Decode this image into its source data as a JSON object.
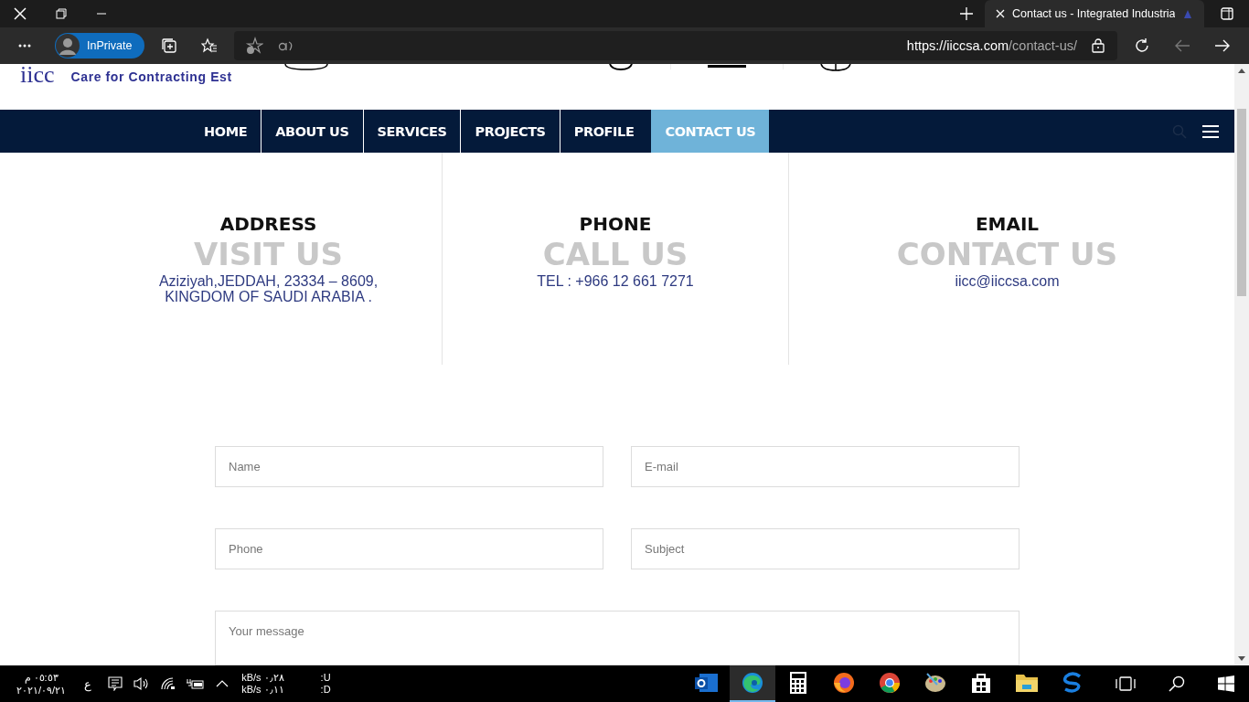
{
  "browser": {
    "tab_title": "Contact us - Integrated Industria",
    "profile": "InPrivate",
    "url_host": "https://iiccsa.com",
    "url_path": "/contact-us/"
  },
  "site": {
    "logo": "iicc",
    "tagline": "Care for Contracting Est"
  },
  "nav": [
    {
      "label": "HOME",
      "selected": false
    },
    {
      "label": "ABOUT US",
      "selected": false
    },
    {
      "label": "SERVICES",
      "selected": false
    },
    {
      "label": "PROJECTS",
      "selected": false
    },
    {
      "label": "PROFILE",
      "selected": false
    },
    {
      "label": "CONTACT US",
      "selected": true
    }
  ],
  "contact": [
    {
      "heading": "ADDRESS",
      "ghost": "VISIT US",
      "lines": [
        "Aziziyah,JEDDAH, 23334 – 8609,",
        "KINGDOM OF SAUDI ARABIA ."
      ]
    },
    {
      "heading": "PHONE",
      "ghost": "CALL US",
      "lines": [
        "TEL : +966 12 661 7271"
      ]
    },
    {
      "heading": "EMAIL",
      "ghost": "CONTACT US",
      "lines": [
        "iicc@iiccsa.com"
      ]
    }
  ],
  "form": [
    {
      "placeholder": "Name",
      "kind": "half"
    },
    {
      "placeholder": "E-mail",
      "kind": "half"
    },
    {
      "placeholder": "Phone",
      "kind": "half"
    },
    {
      "placeholder": "Subject",
      "kind": "half"
    },
    {
      "placeholder": "Your message",
      "kind": "full"
    }
  ],
  "taskbar": {
    "time": "٠٥:٥٣ م",
    "date": "٢٠٢١/٠٩/٢١",
    "language": "ع",
    "upload": "kB/s ٠٫٢٨",
    "download": "kB/s ٠٫١١",
    "upload_label": ":U",
    "download_label": ":D",
    "apps": [
      {
        "kind": "outlook",
        "selected": false
      },
      {
        "kind": "edge",
        "selected": true
      },
      {
        "kind": "calculator",
        "selected": false
      },
      {
        "kind": "firefox",
        "selected": false
      },
      {
        "kind": "chrome",
        "selected": false
      },
      {
        "kind": "paint",
        "selected": false
      },
      {
        "kind": "store",
        "selected": false
      },
      {
        "kind": "explorer",
        "selected": false
      },
      {
        "kind": "swirl",
        "selected": false
      }
    ]
  }
}
